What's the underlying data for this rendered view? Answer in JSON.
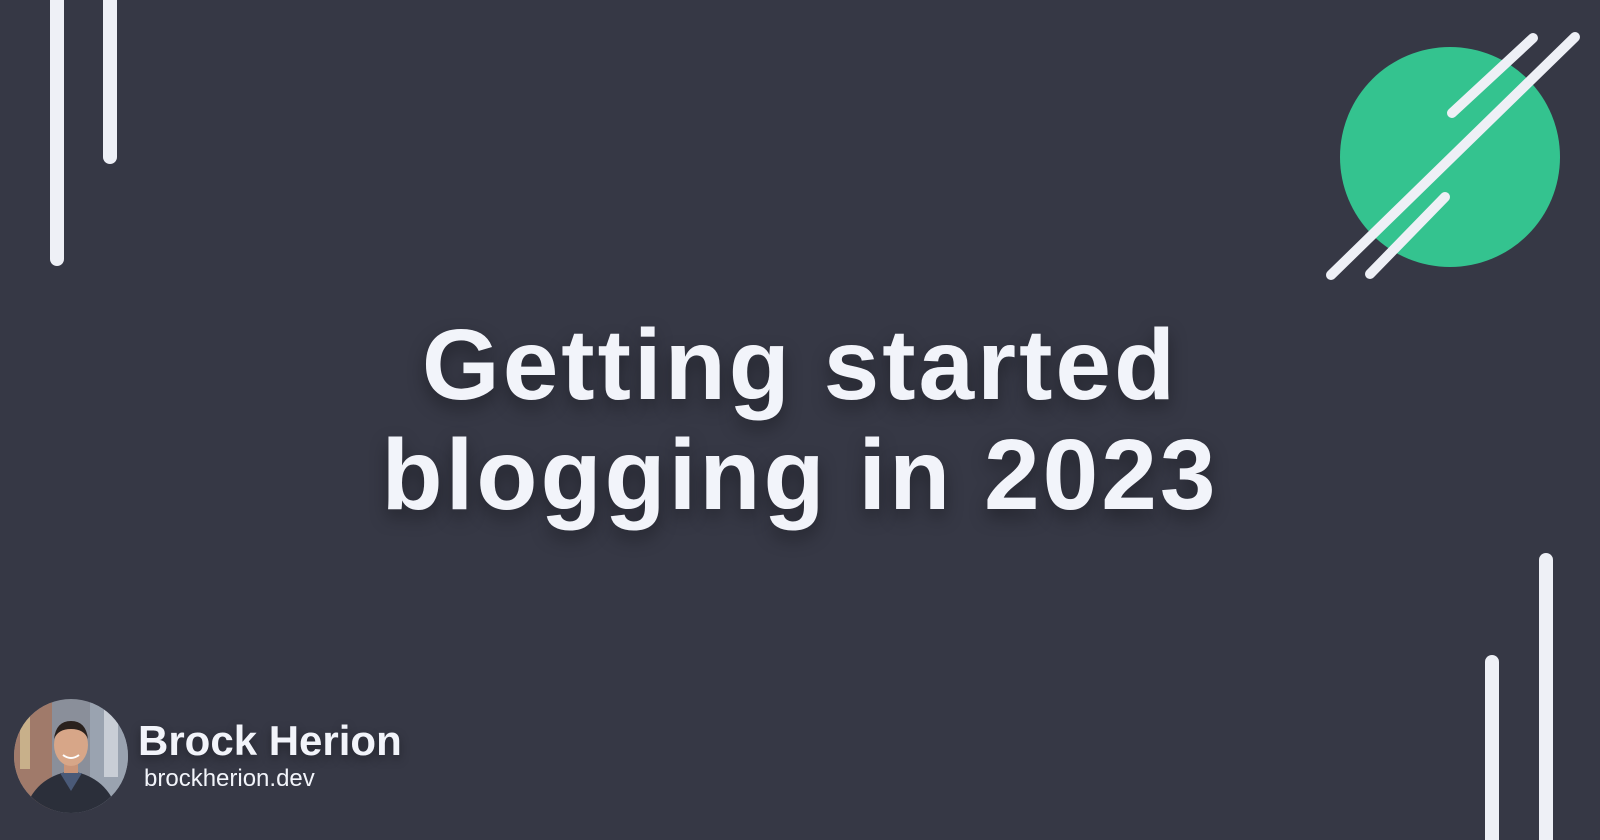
{
  "title": {
    "line1": "Getting started",
    "line2": "blogging in 2023"
  },
  "author": {
    "name": "Brock Herion",
    "website": "brockherion.dev"
  },
  "colors": {
    "background": "#363845",
    "text": "#f2f4fa",
    "accent": "#34c38f"
  },
  "icons": {
    "avatar": "author-photo",
    "decoration": "green-circle-with-slashes"
  }
}
